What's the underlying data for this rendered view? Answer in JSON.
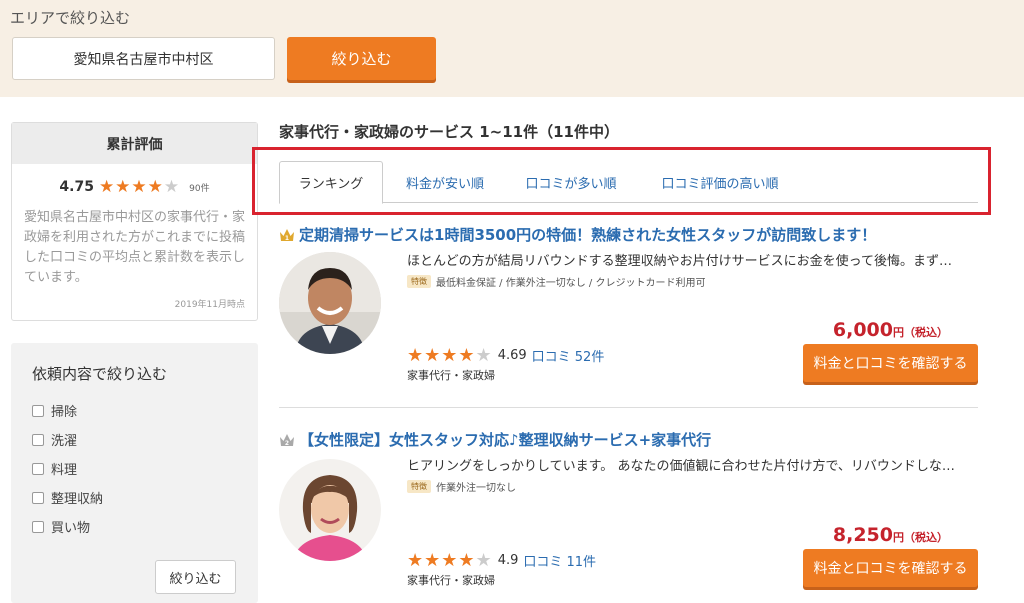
{
  "area_filter": {
    "title": "エリアで絞り込む",
    "value": "愛知県名古屋市中村区",
    "button": "絞り込む"
  },
  "summary": {
    "header": "累計評価",
    "score": "4.75",
    "stars": 4,
    "count": "90件",
    "description": "愛知県名古屋市中村区の家事代行・家政婦を利用された方がこれまでに投稿した口コミの平均点と累計数を表示しています。",
    "date": "2019年11月時点"
  },
  "request_filter": {
    "title": "依頼内容で絞り込む",
    "options": [
      "掃除",
      "洗濯",
      "料理",
      "整理収納",
      "買い物"
    ],
    "button": "絞り込む"
  },
  "results_title": "家事代行・家政婦のサービス 1~11件（11件中）",
  "tabs": [
    "ランキング",
    "料金が安い順",
    "口コミが多い順",
    "口コミ評価の高い順"
  ],
  "listings": [
    {
      "rank": "1",
      "title": "定期清掃サービスは1時間3500円の特価！熟練された女性スタッフが訪問致します！",
      "description": "ほとんどの方が結局リバウンドする整理収納やお片付けサービスにお金を使って後悔。まず…",
      "tag": "特徴",
      "features": "最低料金保証 / 作業外注一切なし / クレジットカード利用可",
      "price": "6,000",
      "price_unit": "円（税込）",
      "stars": 4,
      "rating": "4.69",
      "reviews": "口コミ 52件",
      "category": "家事代行・家政婦",
      "button": "料金と口コミを確認する"
    },
    {
      "rank": "2",
      "title": "【女性限定】女性スタッフ対応♪整理収納サービス+家事代行",
      "description": "ヒアリングをしっかりしています。 あなたの価値観に合わせた片付け方で、リバウンドしな…",
      "tag": "特徴",
      "features": "作業外注一切なし",
      "price": "8,250",
      "price_unit": "円（税込）",
      "stars": 4,
      "rating": "4.9",
      "reviews": "口コミ 11件",
      "category": "家事代行・家政婦",
      "button": "料金と口コミを確認する"
    }
  ],
  "colors": {
    "accent": "#ee7b22",
    "link": "#2b6cb0",
    "price": "#c5232c",
    "highlight": "#d9232f"
  }
}
